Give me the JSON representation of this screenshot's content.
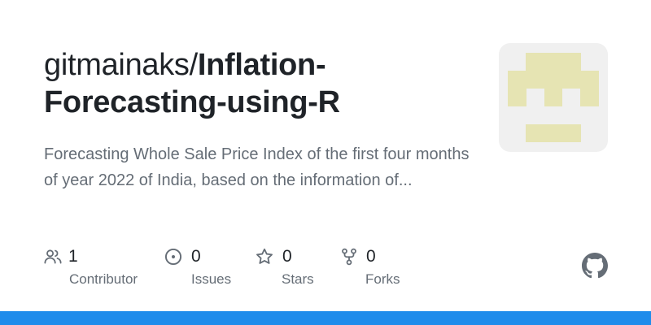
{
  "repo": {
    "owner_prefix": "gitmainaks/",
    "name": "Inflation-Forecasting-using-R",
    "description": "Forecasting Whole Sale Price Index of the first four months of year 2022 of India, based on the information of..."
  },
  "stats": {
    "contributors": {
      "count": "1",
      "label": "Contributor",
      "icon": "people-icon"
    },
    "issues": {
      "count": "0",
      "label": "Issues",
      "icon": "issue-opened-icon"
    },
    "stars": {
      "count": "0",
      "label": "Stars",
      "icon": "star-icon"
    },
    "forks": {
      "count": "0",
      "label": "Forks",
      "icon": "repo-forked-icon"
    }
  },
  "avatar": {
    "color": "#e6e4b3",
    "background": "#f0f0f0"
  },
  "colors": {
    "accent_bar": "#1f8ceb",
    "muted_text": "#656d76",
    "icon": "#656d76"
  }
}
